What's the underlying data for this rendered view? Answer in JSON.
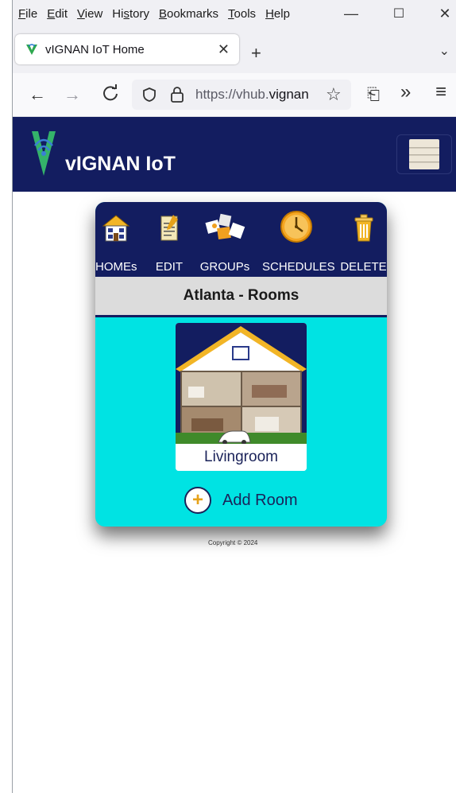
{
  "browser": {
    "menu": [
      "File",
      "Edit",
      "View",
      "History",
      "Bookmarks",
      "Tools",
      "Help"
    ],
    "menu_mnemonic": [
      "F",
      "E",
      "V",
      "s",
      "B",
      "T",
      "H"
    ],
    "window_controls": {
      "minimize": "—",
      "maximize": "☐",
      "close": "✕"
    },
    "tab": {
      "title": "vIGNAN IoT Home",
      "close": "✕"
    },
    "new_tab": "+",
    "tab_list": "⌄",
    "url_prefix": "https://vhub.",
    "url_domain": "vignani",
    "nav": {
      "back": "←",
      "forward": "→",
      "reload": "C",
      "bookmark": "☆",
      "extensions": "⎗",
      "overflow": "»",
      "menu": "≡"
    }
  },
  "site": {
    "brand": "vIGNAN IoT"
  },
  "toolbar": [
    {
      "label": "HOMEs",
      "icon": "house-icon"
    },
    {
      "label": "EDIT",
      "icon": "notepad-icon"
    },
    {
      "label": "GROUPs",
      "icon": "puzzle-pieces-icon"
    },
    {
      "label": "SCHEDULES",
      "icon": "clock-icon"
    },
    {
      "label": "DELETE",
      "icon": "trash-icon"
    }
  ],
  "section_title": "Atlanta - Rooms",
  "rooms": [
    {
      "name": "Livingroom"
    }
  ],
  "add_room_label": "Add Room",
  "add_room_symbol": "+",
  "copyright": "Copyright © 2024",
  "colors": {
    "header_navy": "#131d60",
    "content_cyan": "#00e3e3",
    "section_gray": "#dcdcdc",
    "accent_orange": "#e6a21a"
  }
}
